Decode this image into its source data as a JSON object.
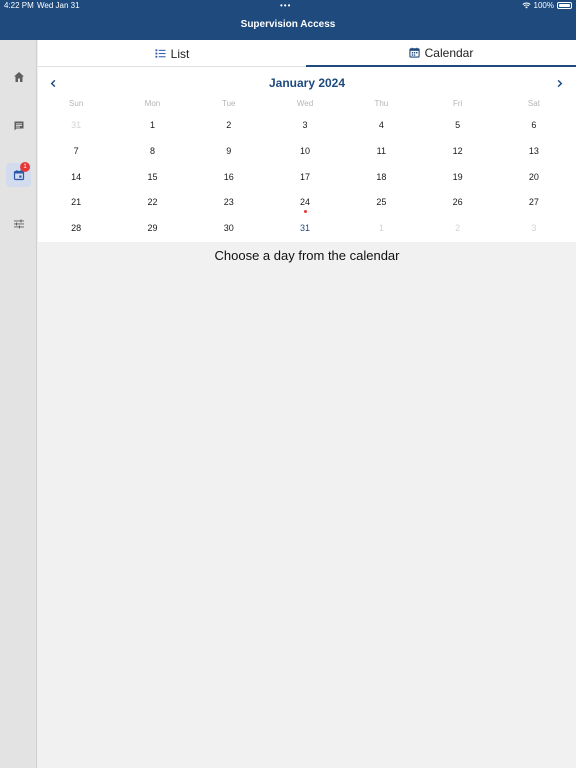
{
  "status_bar": {
    "time": "4:22 PM",
    "date": "Wed Jan 31",
    "dots": "•••",
    "battery": "100%"
  },
  "app": {
    "title": "Supervision Access"
  },
  "sidebar": {
    "items": [
      {
        "name": "home",
        "icon": "home-icon"
      },
      {
        "name": "messages",
        "icon": "chat-icon"
      },
      {
        "name": "calendar",
        "icon": "calendar-icon",
        "badge": "1",
        "active": true
      },
      {
        "name": "settings",
        "icon": "sliders-icon"
      }
    ]
  },
  "tabs": {
    "list": "List",
    "calendar": "Calendar"
  },
  "calendar": {
    "month": "January 2024",
    "weekdays": [
      "Sun",
      "Mon",
      "Tue",
      "Wed",
      "Thu",
      "Fri",
      "Sat"
    ],
    "weeks": [
      [
        "31",
        "1",
        "2",
        "3",
        "4",
        "5",
        "6"
      ],
      [
        "7",
        "8",
        "9",
        "10",
        "11",
        "12",
        "13"
      ],
      [
        "14",
        "15",
        "16",
        "17",
        "18",
        "19",
        "20"
      ],
      [
        "21",
        "22",
        "23",
        "24",
        "25",
        "26",
        "27"
      ],
      [
        "28",
        "29",
        "30",
        "31",
        "1",
        "2",
        "3"
      ]
    ],
    "event_day": "24",
    "today": "31"
  },
  "placeholder": "Choose a day from the calendar",
  "colors": {
    "primary": "#1e4a7e",
    "badge": "#e53935",
    "muted": "#d3d3d3"
  }
}
